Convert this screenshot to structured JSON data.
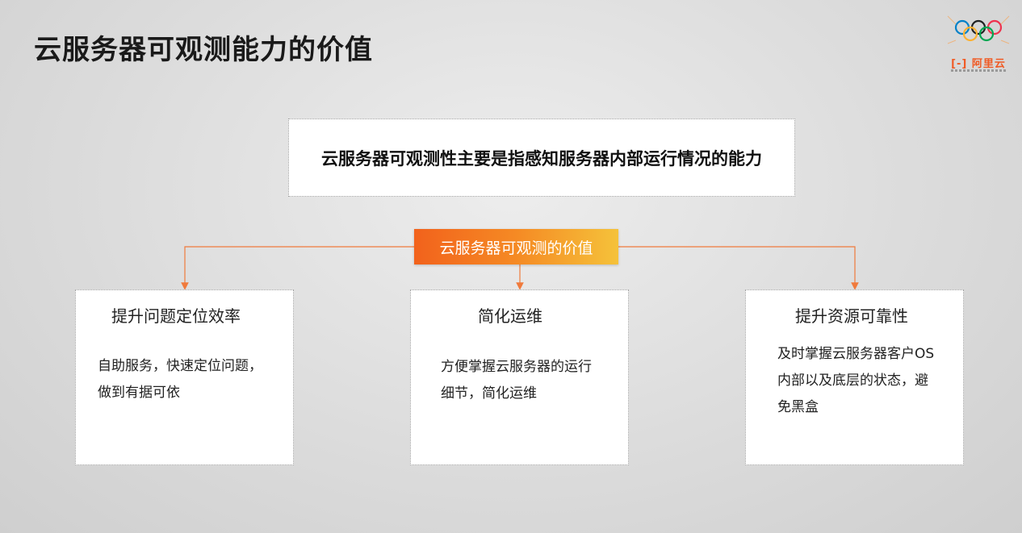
{
  "page": {
    "title": "云服务器可观测能力的价值"
  },
  "logo": {
    "brand_text": "阿里云",
    "icon": "olympic-rings-icon",
    "colors": {
      "blue": "#0081c8",
      "black": "#222222",
      "red": "#ee334e",
      "yellow": "#fcb131",
      "green": "#00a651",
      "brand": "#f05a24"
    }
  },
  "definition": {
    "text": "云服务器可观测性主要是指感知服务器内部运行情况的能力"
  },
  "center": {
    "label": "云服务器可观测的价值",
    "gradient": [
      "#f2621c",
      "#f58a24",
      "#f5c23a"
    ]
  },
  "connector_color": "#f07a3c",
  "cards": [
    {
      "title": "提升问题定位效率",
      "body_lines": [
        "自助服务，快速定位问题，",
        "做到有据可依"
      ]
    },
    {
      "title": "简化运维",
      "body_lines": [
        "方便掌握云服务器的运行",
        "细节，简化运维"
      ]
    },
    {
      "title": "提升资源可靠性",
      "body_lines": [
        "及时掌握云服务器客户OS",
        "内部以及底层的状态，避",
        "免黑盒"
      ]
    }
  ]
}
